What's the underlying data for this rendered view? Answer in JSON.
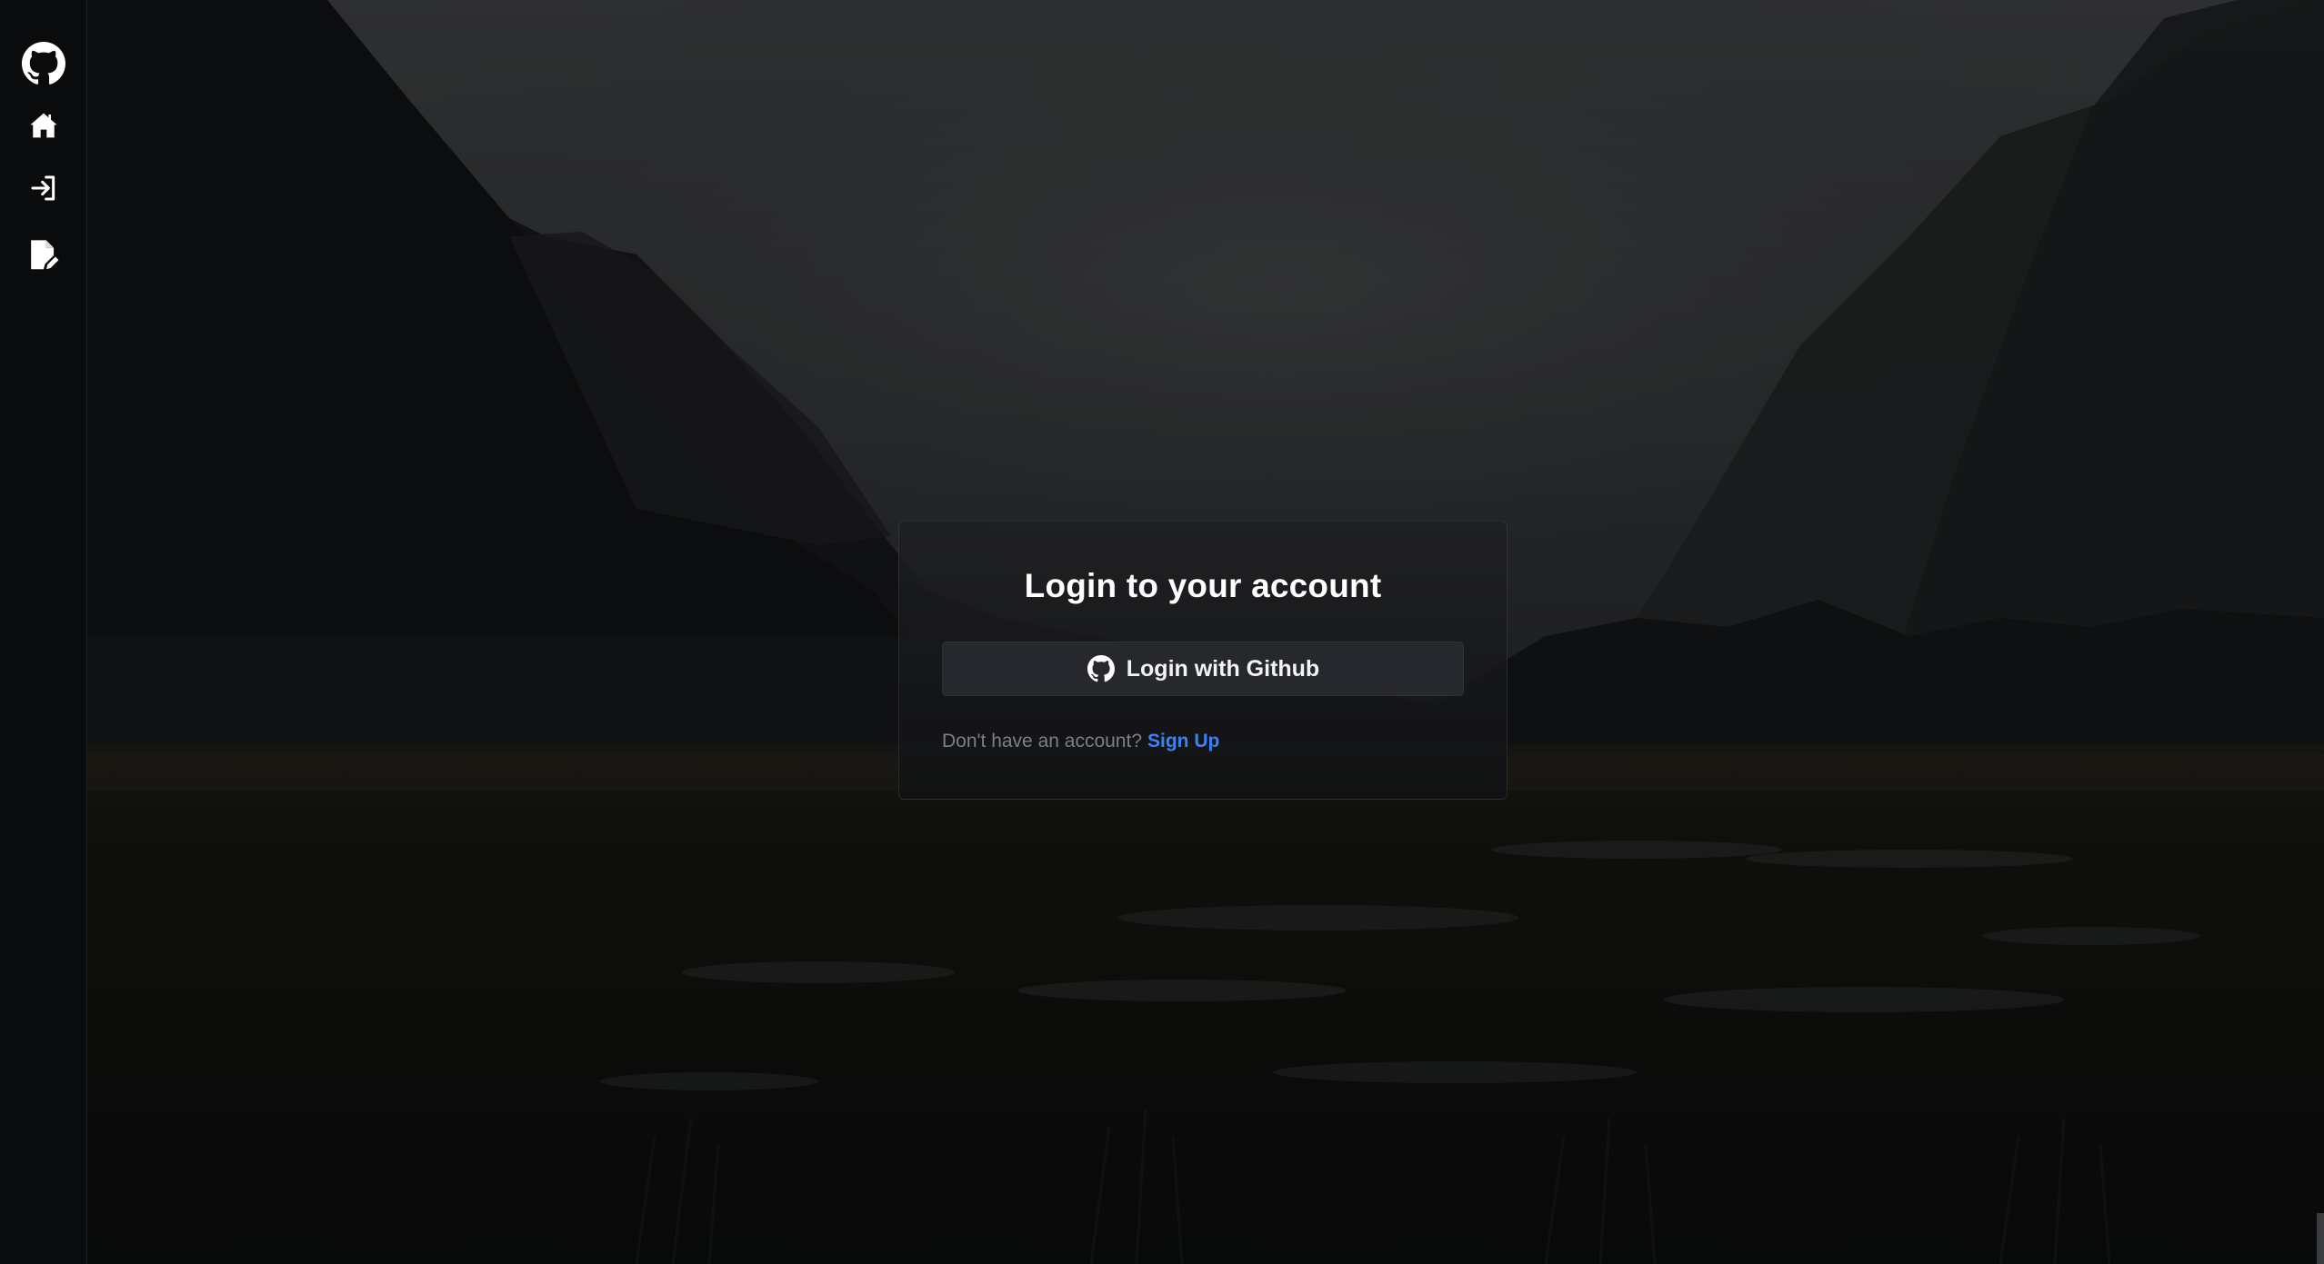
{
  "sidebar": {
    "items": [
      {
        "icon": "github-icon",
        "name": "github"
      },
      {
        "icon": "home-icon",
        "name": "home"
      },
      {
        "icon": "login-icon",
        "name": "login"
      },
      {
        "icon": "signup-icon",
        "name": "signup"
      }
    ]
  },
  "login_card": {
    "title": "Login to your account",
    "github_button_label": "Login with Github",
    "github_button_icon": "github-icon",
    "signup_prompt": "Don't have an account?",
    "signup_link": "Sign Up"
  },
  "colors": {
    "link": "#3b82f6",
    "button_bg": "#26282d",
    "sidebar_bg": "#0a0b0d"
  }
}
